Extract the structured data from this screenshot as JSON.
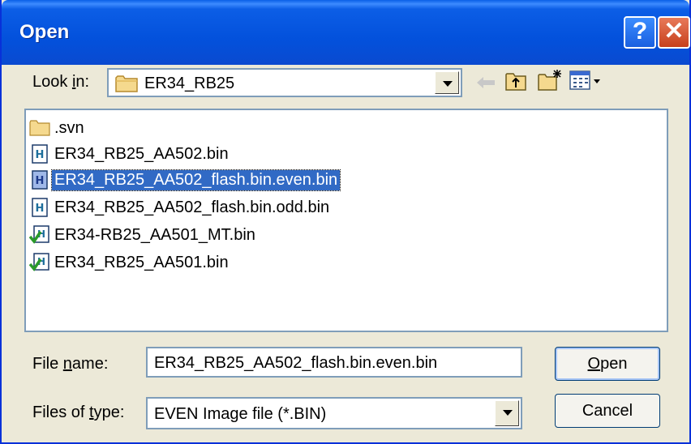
{
  "window": {
    "title": "Open",
    "help_label": "?",
    "close_label": "✕"
  },
  "look_in": {
    "label_pre": "Look ",
    "label_mnemonic": "i",
    "label_post": "n:",
    "value": "ER34_RB25"
  },
  "toolbar": {
    "icons": [
      "back-arrow-icon",
      "up-folder-icon",
      "new-folder-icon",
      "view-menu-icon"
    ]
  },
  "files": [
    {
      "name": ".svn",
      "icon": "folder-icon",
      "selected": false
    },
    {
      "name": "ER34_RB25_AA502.bin",
      "icon": "hex-file-icon",
      "selected": false
    },
    {
      "name": "ER34_RB25_AA502_flash.bin.even.bin",
      "icon": "hex-file-icon",
      "selected": true
    },
    {
      "name": "ER34_RB25_AA502_flash.bin.odd.bin",
      "icon": "hex-file-icon",
      "selected": false
    },
    {
      "name": "ER34-RB25_AA501_MT.bin",
      "icon": "checked-hex-file-icon",
      "selected": false
    },
    {
      "name": "ER34_RB25_AA501.bin",
      "icon": "checked-hex-file-icon",
      "selected": false
    }
  ],
  "file_name": {
    "label_pre": "File ",
    "label_mnemonic": "n",
    "label_post": "ame:",
    "value": "ER34_RB25_AA502_flash.bin.even.bin"
  },
  "file_type": {
    "label_pre": "Files of ",
    "label_mnemonic": "t",
    "label_post": "ype:",
    "value": "EVEN Image file (*.BIN)"
  },
  "buttons": {
    "open_mnemonic": "O",
    "open_rest": "pen",
    "cancel": "Cancel"
  },
  "colors": {
    "title_bar": "#0351dc",
    "selection": "#316ac5",
    "dialog_bg": "#ece9d8"
  }
}
